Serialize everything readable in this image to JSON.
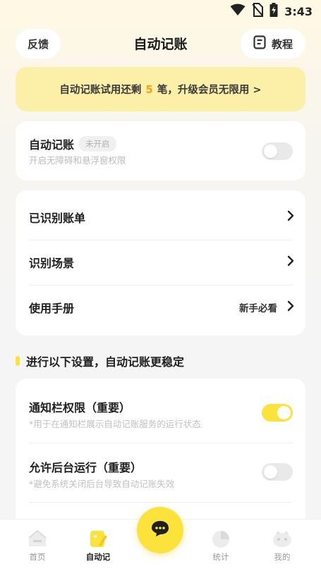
{
  "status_bar": {
    "time": "3:43"
  },
  "header": {
    "feedback_label": "反馈",
    "title": "自动记账",
    "tutorial_label": "教程"
  },
  "promo": {
    "prefix": "自动记账试用还剩",
    "count": "5",
    "suffix": "笔，升级会员无限用 >"
  },
  "auto_card": {
    "title": "自动记账",
    "badge": "未开启",
    "subtitle": "开启无障碍和悬浮窗权限",
    "enabled": false
  },
  "menu": {
    "items": [
      {
        "label": "已识别账单",
        "hint": ""
      },
      {
        "label": "识别场景",
        "hint": ""
      },
      {
        "label": "使用手册",
        "hint": "新手必看"
      }
    ]
  },
  "section": {
    "title": "进行以下设置，自动记账更稳定"
  },
  "settings": {
    "items": [
      {
        "title": "通知栏权限（重要）",
        "subtitle": "*用于在通知栏展示自动记账服务的运行状态",
        "enabled": true
      },
      {
        "title": "允许后台运行（重要）",
        "subtitle": "*避免系统关闭后台导致自动记账失效",
        "enabled": false
      }
    ]
  },
  "tabbar": {
    "items": [
      {
        "label": "首页",
        "icon": "home-icon",
        "active": false
      },
      {
        "label": "自动记",
        "icon": "auto-record-icon",
        "active": true
      },
      {
        "label": "统计",
        "icon": "chart-icon",
        "active": false
      },
      {
        "label": "我的",
        "icon": "profile-icon",
        "active": false
      }
    ],
    "fab_icon": "chat-bubble-icon"
  },
  "colors": {
    "accent": "#fbe33c",
    "promo_bg": "#fcefa8",
    "count_highlight": "#f2a516"
  }
}
